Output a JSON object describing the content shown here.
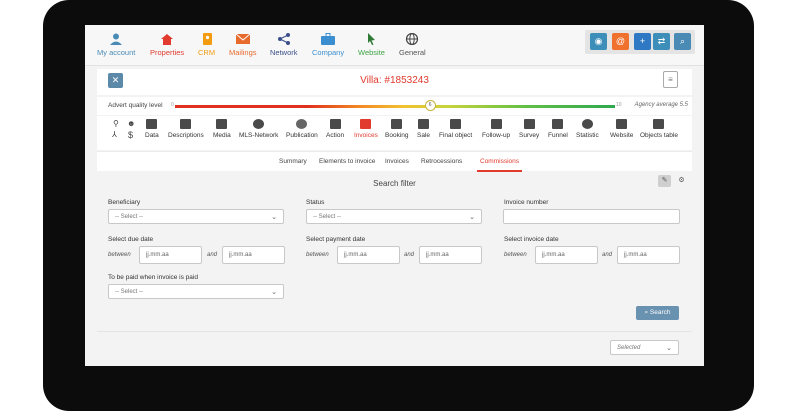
{
  "nav": {
    "items": [
      {
        "label": "My account",
        "color": "#4a8bb5"
      },
      {
        "label": "Properties",
        "color": "#e03b2e"
      },
      {
        "label": "CRM",
        "color": "#f39c12"
      },
      {
        "label": "Mailings",
        "color": "#e86b2e"
      },
      {
        "label": "Network",
        "color": "#3b4f8a"
      },
      {
        "label": "Company",
        "color": "#3b8fd1"
      },
      {
        "label": "Website",
        "color": "#3fa447"
      },
      {
        "label": "General",
        "color": "#555555"
      }
    ],
    "quick_buttons": [
      {
        "icon": "eye-icon",
        "glyph": "◉",
        "color": "#3d8eb9"
      },
      {
        "icon": "at-icon",
        "glyph": "@",
        "color": "#f0702e"
      },
      {
        "icon": "add-user-icon",
        "glyph": "+",
        "color": "#2f78c4"
      },
      {
        "icon": "shuffle-icon",
        "glyph": "⇄",
        "color": "#3d8eb9"
      },
      {
        "icon": "search-icon",
        "glyph": "⌕",
        "color": "#4a8bb5"
      }
    ]
  },
  "title": "Villa: #1853243",
  "quality": {
    "label": "Advert quality level",
    "min": "0",
    "max": "10",
    "value": "6",
    "level": 0.58,
    "agency_average": "Agency average 5.5"
  },
  "modules": [
    {
      "label": "Data",
      "active": false
    },
    {
      "label": "Descriptions",
      "active": false
    },
    {
      "label": "Media",
      "active": false
    },
    {
      "label": "MLS-Network",
      "active": false
    },
    {
      "label": "Publication",
      "active": false
    },
    {
      "label": "Action",
      "active": false
    },
    {
      "label": "Invoices",
      "active": true
    },
    {
      "label": "Booking",
      "active": false
    },
    {
      "label": "Sale",
      "active": false
    },
    {
      "label": "Final object",
      "active": false
    },
    {
      "label": "Follow-up",
      "active": false
    },
    {
      "label": "Survey",
      "active": false
    },
    {
      "label": "Funnel",
      "active": false
    },
    {
      "label": "Statistic",
      "active": false
    },
    {
      "label": "Website",
      "active": false
    },
    {
      "label": "Objects table",
      "active": false
    }
  ],
  "subtabs": [
    {
      "label": "Summary"
    },
    {
      "label": "Elements to invoice"
    },
    {
      "label": "Invoices"
    },
    {
      "label": "Retrocessions"
    },
    {
      "label": "Commissions"
    }
  ],
  "filter": {
    "title": "Search filter",
    "beneficiary": {
      "label": "Beneficiary",
      "value": "-- Select --"
    },
    "status": {
      "label": "Status",
      "value": "-- Select --"
    },
    "invoice_number": {
      "label": "Invoice number",
      "value": ""
    },
    "due_date": {
      "label": "Select due date",
      "between": "between",
      "and": "and",
      "from": "jj.mm.aa",
      "to": "jj.mm.aa"
    },
    "payment_date": {
      "label": "Select payment date",
      "between": "between",
      "and": "and",
      "from": "jj.mm.aa",
      "to": "jj.mm.aa"
    },
    "invoice_date": {
      "label": "Select invoice date",
      "between": "between",
      "and": "and",
      "from": "jj.mm.aa",
      "to": "jj.mm.aa"
    },
    "paid_when": {
      "label": "To be paid when invoice is paid",
      "value": "-- Select --"
    },
    "search_button": "Search"
  },
  "results": {
    "selected_value": "Selected"
  }
}
